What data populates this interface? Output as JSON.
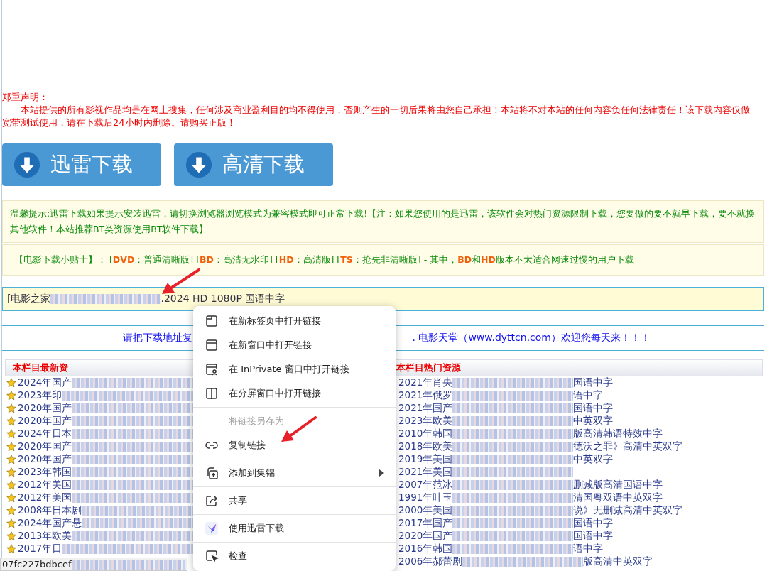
{
  "disclaimer": {
    "title": "郑重声明：",
    "body": "本站提供的所有影视作品均是在网上搜集，任何涉及商业盈利目的均不得使用，否则产生的一切后果将由您自己承担！本站将不对本站的任何内容负任何法律责任！该下载内容仅做宽带测试使用，请在下载后24小时内删除。请购买正版！"
  },
  "download_buttons": [
    {
      "label": "迅雷下载"
    },
    {
      "label": "高清下载"
    }
  ],
  "notice": "温馨提示:迅雷下载如果提示安装迅雷，请切换浏览器浏览模式为兼容模式即可正常下载!【注：如果您使用的是迅雷，该软件会对热门资源限制下载，您要做的要不就早下载，要不就换其他软件！本站推荐BT类资源使用BT软件下载】",
  "tips": [
    {
      "kind": "plain",
      "text": "【电影下载小贴士】： ["
    },
    {
      "kind": "term",
      "text": "DVD"
    },
    {
      "kind": "plain",
      "text": "：普通清晰版] ["
    },
    {
      "kind": "term",
      "text": "BD"
    },
    {
      "kind": "plain",
      "text": "：高清无水印] ["
    },
    {
      "kind": "term",
      "text": "HD"
    },
    {
      "kind": "plain",
      "text": "：高清版] ["
    },
    {
      "kind": "term",
      "text": "TS"
    },
    {
      "kind": "plain",
      "text": "：抢先非清晰版] - 其中，"
    },
    {
      "kind": "term",
      "text": "BD"
    },
    {
      "kind": "plain",
      "text": "和"
    },
    {
      "kind": "term",
      "text": "HD"
    },
    {
      "kind": "plain",
      "text": "版本不太适合网速过慢的用户下载"
    }
  ],
  "download_link": {
    "prefix": "[电影之家",
    "suffix": ".2024 HD 1080P 国语中字"
  },
  "copy_notice": {
    "left": "请把下载地址复",
    "right": ". 电影天堂（www.dyttcn.com）欢迎您每天来！！！"
  },
  "latest": {
    "title": "本栏目最新资",
    "rows": [
      {
        "prefix": "2024年国产"
      },
      {
        "prefix": "2023年印"
      },
      {
        "prefix": "2020年国产"
      },
      {
        "prefix": "2020年国产"
      },
      {
        "prefix": "2024年日本"
      },
      {
        "prefix": "2020年国产"
      },
      {
        "prefix": "2020年国产"
      },
      {
        "prefix": "2023年韩国"
      },
      {
        "prefix": "2012年美国"
      },
      {
        "prefix": "2012年美国"
      },
      {
        "prefix": "2008年日本剧"
      },
      {
        "prefix": "2024年国产悬"
      },
      {
        "prefix": "2013年欧美"
      },
      {
        "prefix": "2017年日"
      }
    ]
  },
  "hot": {
    "title": "本栏目热门资源",
    "rows": [
      {
        "prefix": "2021年肖央",
        "suffix": "国语中字"
      },
      {
        "prefix": "2021年俄罗",
        "suffix": "语中字"
      },
      {
        "prefix": "2021年国产",
        "suffix": "国语中字"
      },
      {
        "prefix": "2023年欧美",
        "suffix": "中英双字"
      },
      {
        "prefix": "2010年韩国",
        "suffix": "版高清韩语特效中字"
      },
      {
        "prefix": "2018年欧美",
        "suffix": "德沃之罪》高清中英双字"
      },
      {
        "prefix": "2019年美国",
        "suffix": "中英双字"
      },
      {
        "prefix": "2021年美国"
      },
      {
        "prefix": "2007年范冰",
        "suffix": "删减版高清国语中字"
      },
      {
        "prefix": "1991年叶玉",
        "suffix": "清国粤双语中英双字"
      },
      {
        "prefix": "2000年美国",
        "suffix": "说》无删减高清中英双字"
      },
      {
        "prefix": "2017年国产",
        "suffix": "国语中字"
      },
      {
        "prefix": "2020年国产",
        "suffix": "国语中字"
      },
      {
        "prefix": "2016年韩国",
        "suffix": "语中字"
      },
      {
        "prefix": "2006年郝蕾剧",
        "suffix": "版高清中英双字"
      }
    ]
  },
  "context_menu": [
    [
      {
        "label": "在新标签页中打开链接",
        "disabled": false,
        "submenu": false
      },
      {
        "label": "在新窗口中打开链接",
        "disabled": false,
        "submenu": false
      },
      {
        "label": "在 InPrivate 窗口中打开链接",
        "disabled": false,
        "submenu": false
      },
      {
        "label": "在分屏窗口中打开链接",
        "disabled": false,
        "submenu": false
      }
    ],
    [
      {
        "label": "将链接另存为",
        "disabled": true,
        "submenu": false
      },
      {
        "label": "复制链接",
        "disabled": false,
        "submenu": false
      }
    ],
    [
      {
        "label": "添加到集锦",
        "disabled": false,
        "submenu": true
      }
    ],
    [
      {
        "label": "共享",
        "disabled": false,
        "submenu": false
      }
    ],
    [
      {
        "label": "使用迅雷下载",
        "disabled": false,
        "submenu": false
      }
    ],
    [
      {
        "label": "检查",
        "disabled": false,
        "submenu": false
      }
    ]
  ],
  "status_bar": "07fc227bdbcef"
}
